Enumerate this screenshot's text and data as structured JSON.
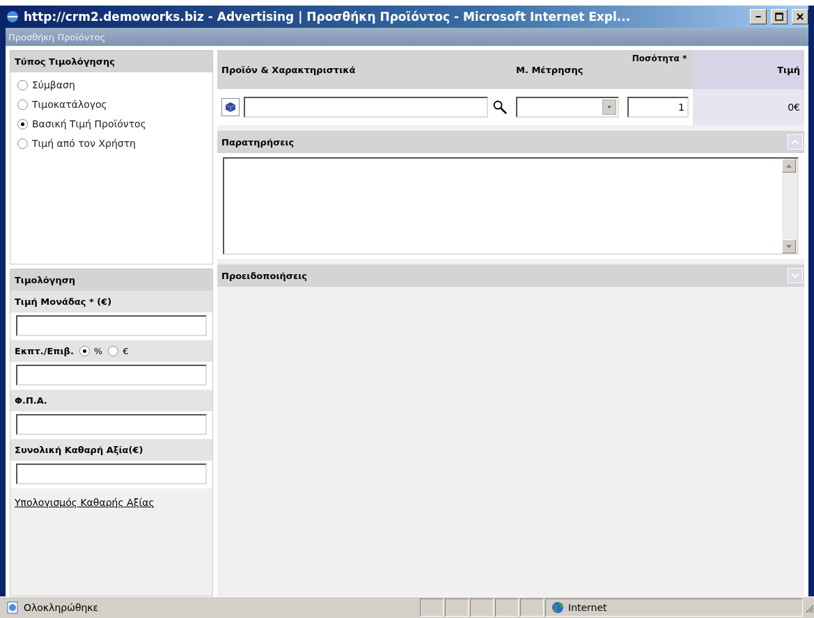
{
  "window": {
    "title": "http://crm2.demoworks.biz - Advertising | Προσθήκη Προϊόντος - Microsoft Internet Expl..."
  },
  "dialog_title": "Προσθήκη Προϊόντος",
  "pricing_type": {
    "heading": "Τύπος Τιμολόγησης",
    "options": [
      {
        "label": "Σύμβαση",
        "selected": false
      },
      {
        "label": "Τιμοκατάλογος",
        "selected": false
      },
      {
        "label": "Βασική Τιμή Προϊόντος",
        "selected": true
      },
      {
        "label": "Τιμή από τον Χρήστη",
        "selected": false
      }
    ]
  },
  "pricing": {
    "heading": "Τιμολόγηση",
    "fields": [
      {
        "kind": "text",
        "label": "Τιμή Μονάδας * (€)"
      },
      {
        "kind": "discount",
        "label": "Εκπτ./Επιβ.",
        "units": [
          {
            "label": "%",
            "selected": true
          },
          {
            "label": "€",
            "selected": false
          }
        ]
      },
      {
        "kind": "text",
        "label": "Φ.Π.Α."
      },
      {
        "kind": "text",
        "label": "Συνολική Καθαρή Αξία(€)"
      }
    ],
    "link": "Υπολογισμός Καθαρής Αξίας"
  },
  "product_table": {
    "columns": [
      "Προϊόν & Χαρακτηριστικά",
      "Μ. Μέτρησης",
      "Ποσότητα *",
      "Τιμή"
    ],
    "row": {
      "quantity": "1",
      "price": "0€"
    }
  },
  "sections": [
    {
      "title": "Παρατηρήσεις",
      "expanded": true
    },
    {
      "title": "Προειδοποιήσεις",
      "expanded": false
    }
  ],
  "status_bar": {
    "text": "Ολοκληρώθηκε",
    "zone": "Internet"
  }
}
